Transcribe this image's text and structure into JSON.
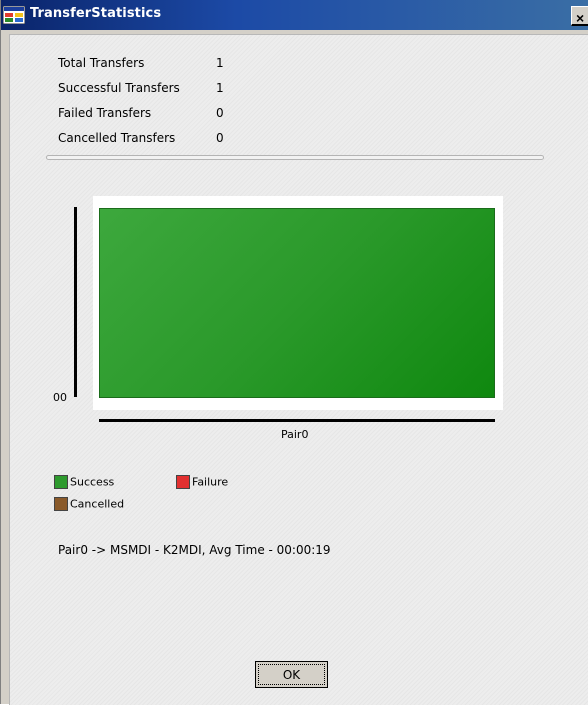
{
  "window": {
    "title": "TransferStatistics",
    "close_label": "×",
    "app_icon": "app-window-icon"
  },
  "stats": [
    {
      "label": "Total Transfers",
      "value": "1"
    },
    {
      "label": "Successful Transfers",
      "value": "1"
    },
    {
      "label": "Failed Transfers",
      "value": "0"
    },
    {
      "label": "Cancelled Transfers",
      "value": "0"
    }
  ],
  "chart": {
    "y_tick": "00",
    "x_tick": "Pair0"
  },
  "legend": [
    {
      "label": "Success",
      "color": "#2e9a2e"
    },
    {
      "label": "Failure",
      "color": "#e23030"
    },
    {
      "label": "Cancelled",
      "color": "#8a5a2a"
    }
  ],
  "summary": "Pair0 -> MSMDI - K2MDI, Avg Time - 00:00:19",
  "buttons": {
    "ok": "OK"
  },
  "chart_data": {
    "type": "bar",
    "categories": [
      "Pair0"
    ],
    "series": [
      {
        "name": "Success",
        "values": [
          1
        ],
        "color": "#2e9a2e"
      },
      {
        "name": "Failure",
        "values": [
          0
        ],
        "color": "#e23030"
      },
      {
        "name": "Cancelled",
        "values": [
          0
        ],
        "color": "#8a5a2a"
      }
    ],
    "y_tick_labels": [
      "00"
    ],
    "x_tick_labels": [
      "Pair0"
    ],
    "ylim": [
      0,
      1
    ],
    "grid": false,
    "legend_position": "bottom-left"
  }
}
